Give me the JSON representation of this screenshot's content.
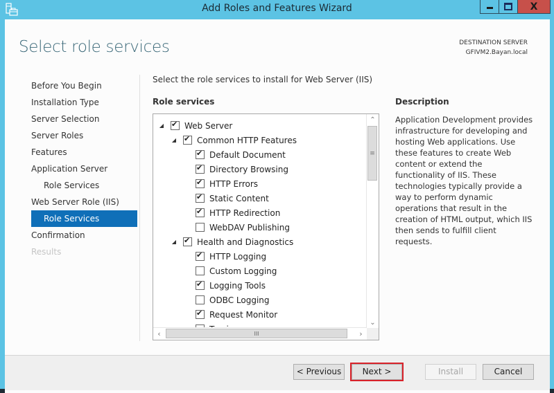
{
  "window": {
    "title": "Add Roles and Features Wizard",
    "icon": "server-manager-icon",
    "controls": {
      "minimize": "minimize",
      "maximize": "maximize",
      "close": "X"
    }
  },
  "header": {
    "page_title": "Select role services",
    "destination_label": "DESTINATION SERVER",
    "destination_server": "GFIVM2.Bayan.local"
  },
  "nav": {
    "items": [
      {
        "label": "Before You Begin",
        "state": "normal"
      },
      {
        "label": "Installation Type",
        "state": "normal"
      },
      {
        "label": "Server Selection",
        "state": "normal"
      },
      {
        "label": "Server Roles",
        "state": "normal"
      },
      {
        "label": "Features",
        "state": "normal"
      },
      {
        "label": "Application Server",
        "state": "normal"
      },
      {
        "label": "Role Services",
        "state": "sub"
      },
      {
        "label": "Web Server Role (IIS)",
        "state": "normal"
      },
      {
        "label": "Role Services",
        "state": "active"
      },
      {
        "label": "Confirmation",
        "state": "normal"
      },
      {
        "label": "Results",
        "state": "disabled"
      }
    ]
  },
  "main": {
    "instruction": "Select the role services to install for Web Server (IIS)",
    "role_services_label": "Role services",
    "tree": [
      {
        "label": "Web Server",
        "level": 0,
        "expandable": true,
        "checked": true
      },
      {
        "label": "Common HTTP Features",
        "level": 1,
        "expandable": true,
        "checked": true
      },
      {
        "label": "Default Document",
        "level": 2,
        "expandable": false,
        "checked": true
      },
      {
        "label": "Directory Browsing",
        "level": 2,
        "expandable": false,
        "checked": true
      },
      {
        "label": "HTTP Errors",
        "level": 2,
        "expandable": false,
        "checked": true
      },
      {
        "label": "Static Content",
        "level": 2,
        "expandable": false,
        "checked": true
      },
      {
        "label": "HTTP Redirection",
        "level": 2,
        "expandable": false,
        "checked": true
      },
      {
        "label": "WebDAV Publishing",
        "level": 2,
        "expandable": false,
        "checked": false
      },
      {
        "label": "Health and Diagnostics",
        "level": 1,
        "expandable": true,
        "checked": true
      },
      {
        "label": "HTTP Logging",
        "level": 2,
        "expandable": false,
        "checked": true
      },
      {
        "label": "Custom Logging",
        "level": 2,
        "expandable": false,
        "checked": false
      },
      {
        "label": "Logging Tools",
        "level": 2,
        "expandable": false,
        "checked": true
      },
      {
        "label": "ODBC Logging",
        "level": 2,
        "expandable": false,
        "checked": false
      },
      {
        "label": "Request Monitor",
        "level": 2,
        "expandable": false,
        "checked": true
      },
      {
        "label": "Tracing",
        "level": 2,
        "expandable": false,
        "checked": false
      }
    ],
    "scroll_glyphs": {
      "up": "^",
      "down": "v",
      "left": "<",
      "right": ">",
      "v_grip": "≡",
      "h_grip": "III"
    }
  },
  "description": {
    "title": "Description",
    "text": "Application Development provides infrastructure for developing and hosting Web applications. Use these features to create Web content or extend the functionality of IIS. These technologies typically provide a way to perform dynamic operations that result in the creation of HTML output, which IIS then sends to fulfill client requests."
  },
  "footer": {
    "previous": "< Previous",
    "next": "Next >",
    "install": "Install",
    "cancel": "Cancel"
  },
  "colors": {
    "titlebar": "#5cc3e4",
    "close_button": "#c7504a",
    "nav_active": "#0f6fb8",
    "page_title": "#3a6878",
    "highlight_outline": "#d9222a"
  }
}
